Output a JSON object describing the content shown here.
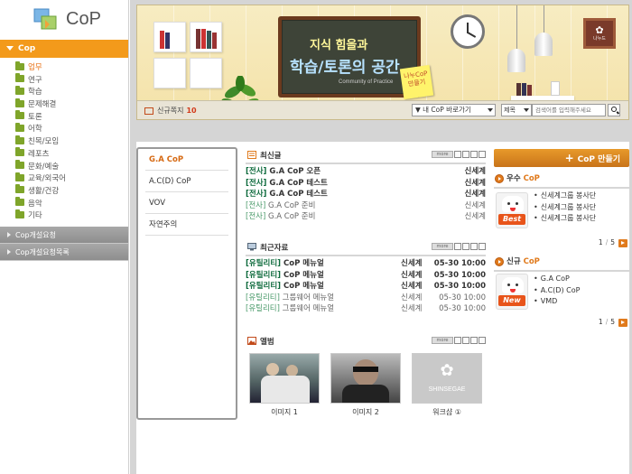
{
  "sidebar": {
    "logo_text": "CoP",
    "section_title": "Cop",
    "menu": [
      {
        "label": "업무",
        "active": true
      },
      {
        "label": "연구",
        "active": false
      },
      {
        "label": "학습",
        "active": false
      },
      {
        "label": "문제해결",
        "active": false
      },
      {
        "label": "토론",
        "active": false
      },
      {
        "label": "어학",
        "active": false
      },
      {
        "label": "친목/모임",
        "active": false
      },
      {
        "label": "레포츠",
        "active": false
      },
      {
        "label": "문화/예술",
        "active": false
      },
      {
        "label": "교육/외국어",
        "active": false
      },
      {
        "label": "생활/건강",
        "active": false
      },
      {
        "label": "음악",
        "active": false
      },
      {
        "label": "기타",
        "active": false
      }
    ],
    "links": [
      "Cop개설요청",
      "Cop개설요청목록"
    ]
  },
  "banner": {
    "title_line1": "지식 힘을과",
    "title_line2": "학습/토론의 공간",
    "subtitle": "Community of Practice",
    "postit": "나누CoP\n만들기",
    "frame_label": "나누드",
    "new_notice_label": "신규쪽지",
    "new_notice_count": "10",
    "cop_goto_label": "▼ 내 CoP 바로가기",
    "search_type": "제목",
    "search_placeholder": "검색어를 입력해주세요"
  },
  "cop_list": [
    "G.A CoP",
    "A.C(D) CoP",
    "VOV",
    "자연주의"
  ],
  "sections": {
    "latest": {
      "title": "최신글",
      "more": "more",
      "rows": [
        {
          "tag": "[전사]",
          "title": "G.A CoP 오픈",
          "author": "신세계",
          "style": "bold"
        },
        {
          "tag": "[전사]",
          "title": "G.A CoP 테스트",
          "author": "신세계",
          "style": "bold"
        },
        {
          "tag": "[전사]",
          "title": "G.A CoP 테스트",
          "author": "신세계",
          "style": "bold"
        },
        {
          "tag": "[전사]",
          "title": "G.A CoP 준비",
          "author": "신세계",
          "style": "light"
        },
        {
          "tag": "[전사]",
          "title": "G.A CoP 준비",
          "author": "신세계",
          "style": "light"
        }
      ]
    },
    "resources": {
      "title": "최근자료",
      "more": "more",
      "rows": [
        {
          "tag": "[유틸리티]",
          "title": "CoP 메뉴얼",
          "author": "신세계",
          "date": "05-30 10:00",
          "style": "bold"
        },
        {
          "tag": "[유틸리티]",
          "title": "CoP 메뉴얼",
          "author": "신세계",
          "date": "05-30 10:00",
          "style": "bold"
        },
        {
          "tag": "[유틸리티]",
          "title": "CoP 메뉴얼",
          "author": "신세계",
          "date": "05-30 10:00",
          "style": "bold"
        },
        {
          "tag": "[유틸리티]",
          "title": "그룹웨어 메뉴얼",
          "author": "신세계",
          "date": "05-30 10:00",
          "style": "light"
        },
        {
          "tag": "[유틸리티]",
          "title": "그룹웨어 메뉴얼",
          "author": "신세계",
          "date": "05-30 10:00",
          "style": "light"
        }
      ]
    },
    "album": {
      "title": "앨범",
      "more": "more",
      "items": [
        {
          "caption": "이미지 1"
        },
        {
          "caption": "이미지 2"
        },
        {
          "caption": "워크샵 ①",
          "logo_text": "SHINSEGAE"
        }
      ]
    }
  },
  "right": {
    "make_cop": "CoP 만들기",
    "best": {
      "title_a": "우수",
      "title_b": "CoP",
      "badge": "Best",
      "items": [
        "신세계그룹 봉사단",
        "신세계그룹 봉사단",
        "신세계그룹 봉사단"
      ],
      "page": "1",
      "pages": "5"
    },
    "newcop": {
      "title_a": "신규",
      "title_b": "CoP",
      "badge": "New",
      "items": [
        "G.A CoP",
        "A.C(D) CoP",
        "VMD"
      ],
      "page": "1",
      "pages": "5"
    }
  }
}
